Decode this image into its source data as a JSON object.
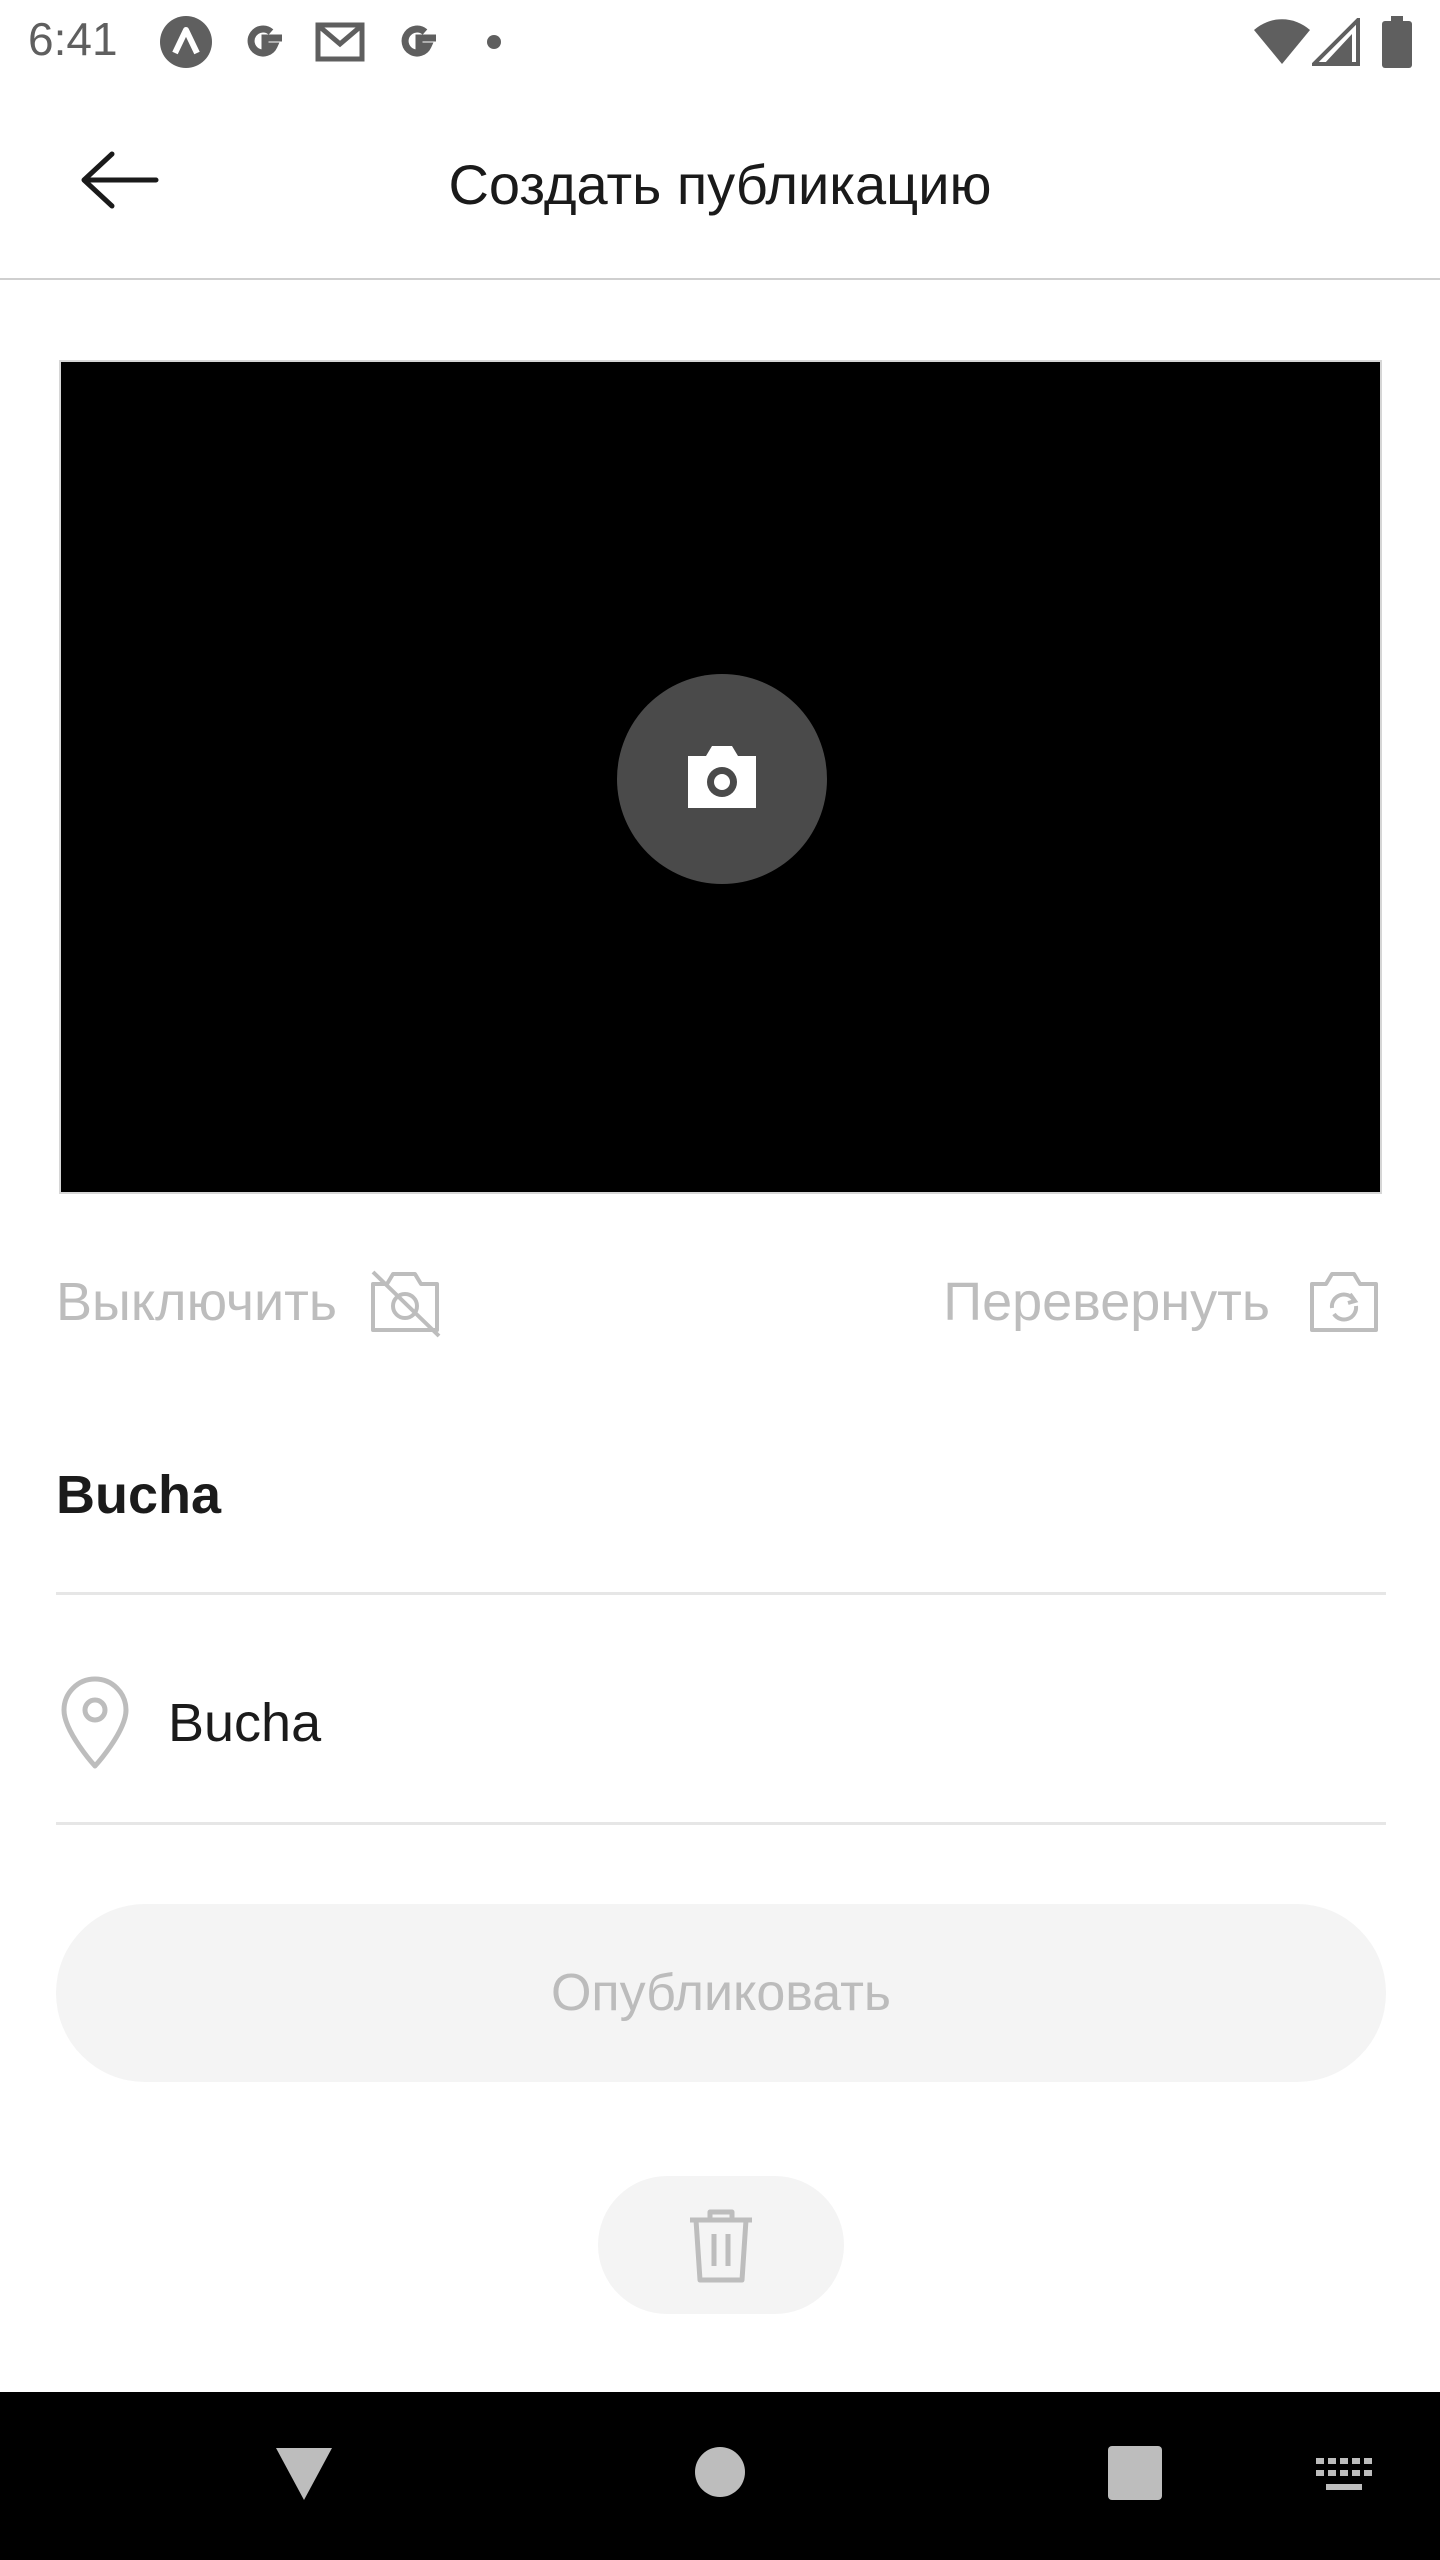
{
  "status_bar": {
    "time": "6:41",
    "notification_icons": [
      "app-a-icon",
      "google-icon",
      "gmail-icon",
      "google-icon",
      "more-dot-icon"
    ],
    "system_icons": [
      "wifi-icon",
      "cell-signal-icon",
      "battery-icon"
    ]
  },
  "header": {
    "title": "Создать публикацию",
    "back_icon": "arrow-left-icon"
  },
  "camera": {
    "shutter_icon": "camera-icon",
    "turn_off_label": "Выключить",
    "turn_off_icon": "camera-off-icon",
    "flip_label": "Перевернуть",
    "flip_icon": "camera-flip-icon"
  },
  "form": {
    "title_value": "Bucha",
    "location_value": "Bucha",
    "location_icon": "location-pin-icon"
  },
  "actions": {
    "publish_label": "Опубликовать",
    "delete_icon": "trash-icon"
  },
  "nav_bar": {
    "icons": [
      "back-triangle-icon",
      "home-circle-icon",
      "recents-square-icon",
      "keyboard-icon"
    ]
  },
  "colors": {
    "text_primary": "#1b1b1b",
    "text_disabled": "#bcbcbc",
    "button_bg_disabled": "#f4f4f4",
    "divider": "#e6e6e6",
    "preview_bg": "#000000",
    "shutter_bg": "#4a4a4a"
  }
}
